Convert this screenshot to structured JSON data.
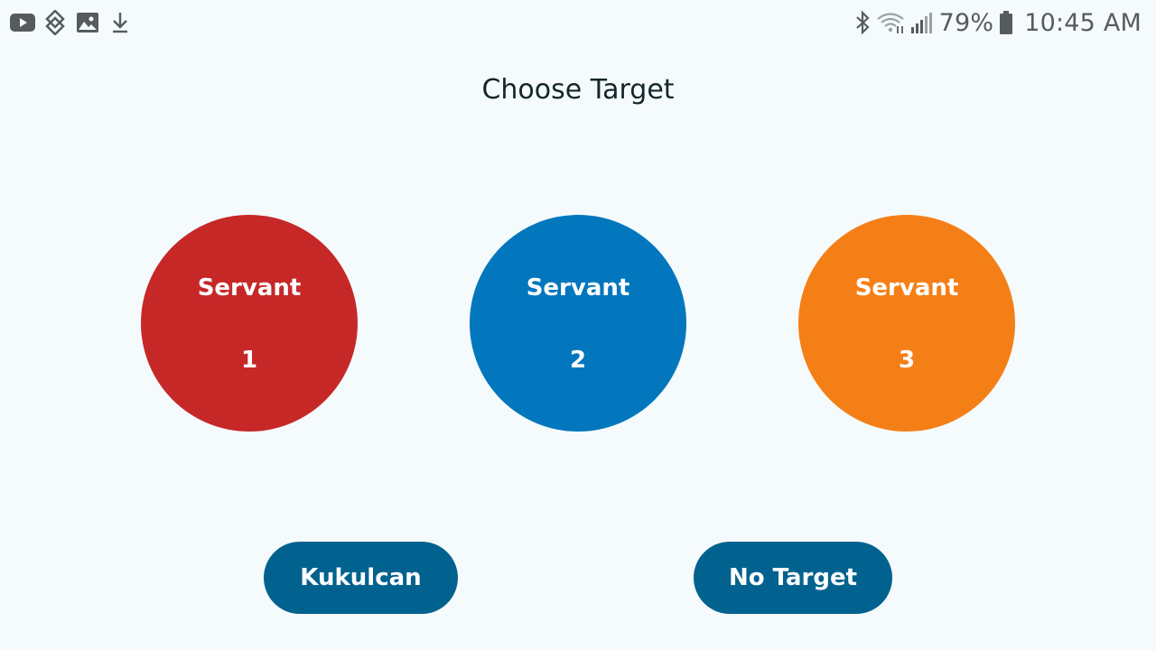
{
  "status_bar": {
    "left_icons": [
      "youtube-icon",
      "diamond-app-icon",
      "gallery-icon",
      "download-icon"
    ],
    "right_icons": [
      "bluetooth-icon",
      "wifi-icon",
      "signal-icon",
      "battery-icon"
    ],
    "battery": "79%",
    "time": "10:45 AM"
  },
  "screen": {
    "title": "Choose Target"
  },
  "targets": [
    {
      "label": "Servant",
      "number": "1",
      "color": "#c62828"
    },
    {
      "label": "Servant",
      "number": "2",
      "color": "#0277bd"
    },
    {
      "label": "Servant",
      "number": "3",
      "color": "#f57f17"
    }
  ],
  "actions": {
    "kukulcan_label": "Kukulcan",
    "no_target_label": "No Target",
    "button_color": "#02628f"
  }
}
